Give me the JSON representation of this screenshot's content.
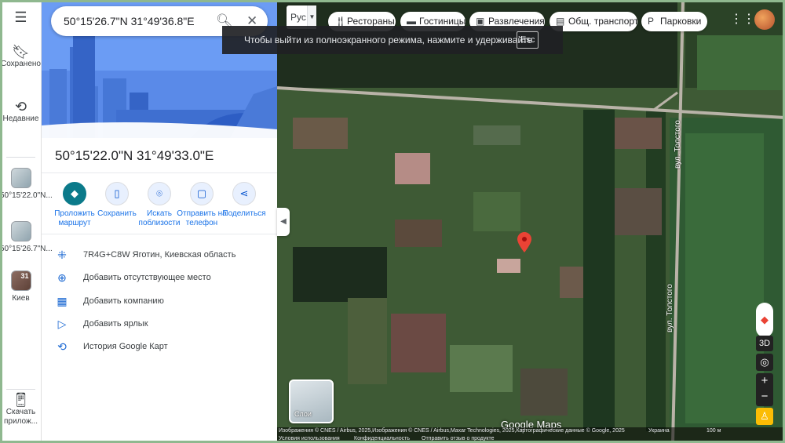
{
  "search": {
    "value": "50°15'26.7\"N 31°49'36.8\"E"
  },
  "rail": {
    "saved": "Сохранено",
    "recent": "Недавние",
    "history_item_1": "50°15'22.0\"N...",
    "history_item_2": "50°15'26.7\"N...",
    "kiev": "Киев",
    "kiev_badge": "31",
    "download": "Скачать прилож..."
  },
  "place": {
    "title": "50°15'22.0\"N 31°49'33.0\"E"
  },
  "actions": [
    {
      "label": "Проложить маршрут"
    },
    {
      "label": "Сохранить"
    },
    {
      "label": "Искать поблизости"
    },
    {
      "label": "Отправить на телефон"
    },
    {
      "label": "Поделиться"
    }
  ],
  "details": [
    {
      "label": "7R4G+C8W Яготин, Киевская область"
    },
    {
      "label": "Добавить отсутствующее место"
    },
    {
      "label": "Добавить компанию"
    },
    {
      "label": "Добавить ярлык"
    },
    {
      "label": "История Google Карт"
    }
  ],
  "map": {
    "lang": "Рус",
    "chips": [
      {
        "label": "Рестораны"
      },
      {
        "label": "Гостиницы"
      },
      {
        "label": "Развлечения"
      },
      {
        "label": "Общ. транспорт"
      },
      {
        "label": "Парковки"
      }
    ],
    "toast": "Чтобы выйти из полноэкранного режима, нажмите и удерживайте",
    "toast_key": "Esc",
    "road_1": "вул. Толстого",
    "road_2": "вул. Толстого",
    "layers": "Слои",
    "ctl_3d": "3D",
    "zoom_in": "+",
    "zoom_out": "−",
    "logo": "Google Maps",
    "attribution": "Изображения © CNES / Airbus, 2025,Изображения © CNES / Airbus,Maxar Technologies, 2025,Картографические данные © Google, 2025",
    "region": "Украина",
    "scale": "100 м",
    "terms": "Условия использования",
    "privacy": "Конфиденциальность",
    "feedback": "Отправить отзыв о продукте"
  },
  "colors": {
    "accent": "#1a73e8",
    "primary_action": "#0b7a8a",
    "pin": "#ea4335"
  }
}
